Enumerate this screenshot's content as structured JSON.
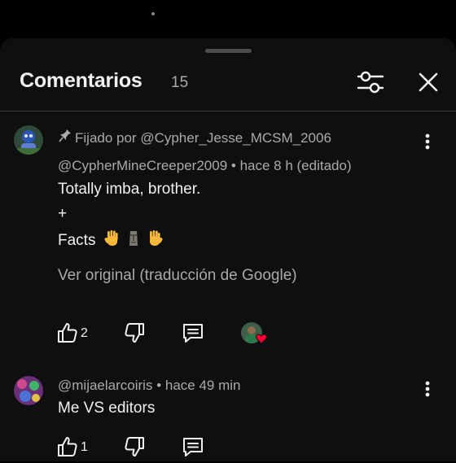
{
  "header": {
    "title": "Comentarios",
    "count": "15"
  },
  "comments": [
    {
      "pinned_label": "Fijado por @Cypher_Jesse_MCSM_2006",
      "author": "@CypherMineCreeper2009",
      "time": "• hace 8 h (editado)",
      "lines": [
        "Totally imba, brother.",
        "+",
        "Facts"
      ],
      "translate_label": "Ver original (traducción de Google)",
      "likes": "2"
    },
    {
      "author": "@mijaelarcoiris",
      "time": "• hace 49 min",
      "lines": [
        "Me VS editors"
      ],
      "likes": "1"
    }
  ],
  "icons": {
    "filter": "sliders-icon",
    "close": "close-icon",
    "pin": "pin-icon",
    "like": "thumbs-up-icon",
    "dislike": "thumbs-down-icon",
    "reply": "reply-icon",
    "more": "more-vert-icon",
    "heart": "heart-icon"
  },
  "colors": {
    "background": "#000000",
    "sheet": "#0f0f0f",
    "text": "#f1f1f1",
    "secondary": "#aaaaaa",
    "heart": "#ff0033"
  }
}
